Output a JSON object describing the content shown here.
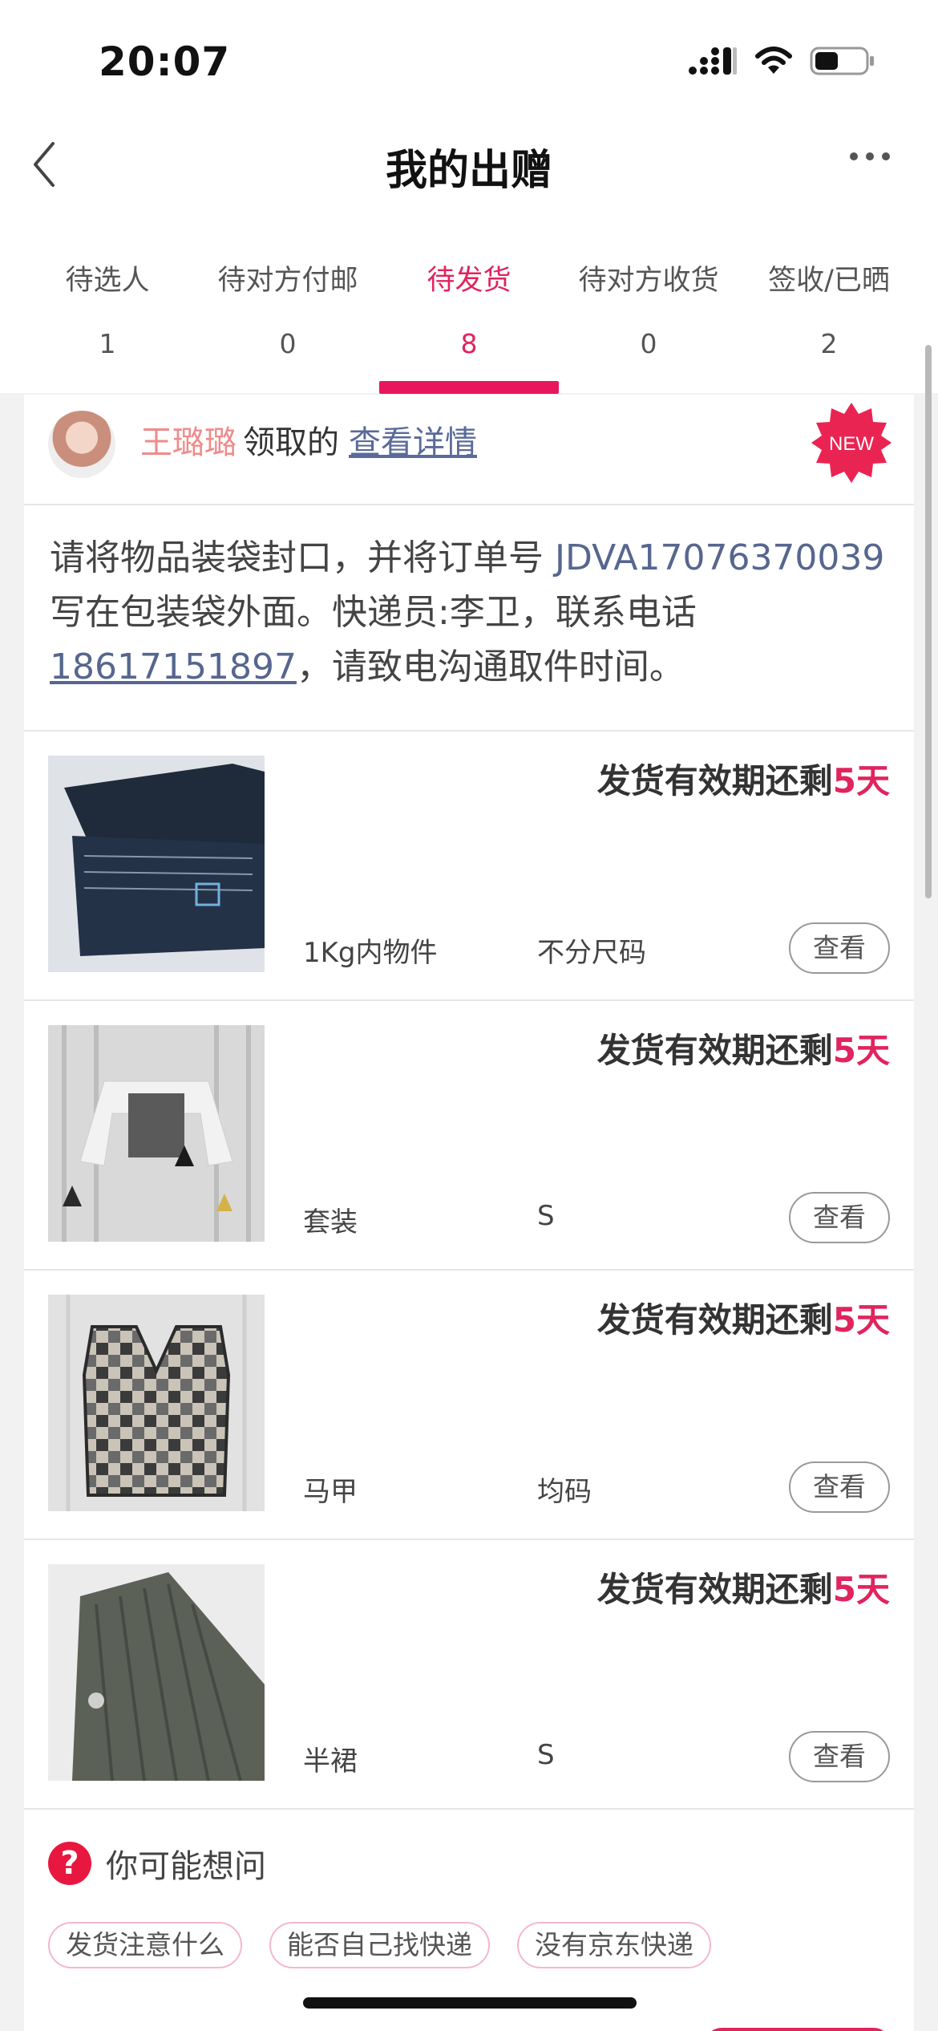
{
  "status_bar": {
    "time": "20:07"
  },
  "nav": {
    "title": "我的出赠"
  },
  "tabs": [
    {
      "label": "待选人",
      "count": "1"
    },
    {
      "label": "待对方付邮",
      "count": "0"
    },
    {
      "label": "待发货",
      "count": "8"
    },
    {
      "label": "待对方收货",
      "count": "0"
    },
    {
      "label": "签收/已晒",
      "count": "2"
    }
  ],
  "active_tab_index": 2,
  "receiver": {
    "name": "王璐璐",
    "action": "领取的",
    "link": "查看详情",
    "badge": "NEW"
  },
  "notice": {
    "part1": "请将物品装袋封口，并将订单号 ",
    "order_no": "JDVA17076370039",
    "part2": " 写在包装袋外面。快递员:李卫，联系电话",
    "phone": "18617151897",
    "part3": "，请致电沟通取件时间。"
  },
  "items": [
    {
      "deadline_prefix": "发货有效期还剩",
      "deadline_days": "5天",
      "name": "1Kg内物件",
      "size": "不分尺码",
      "button": "查看"
    },
    {
      "deadline_prefix": "发货有效期还剩",
      "deadline_days": "5天",
      "name": "套装",
      "size": "S",
      "button": "查看"
    },
    {
      "deadline_prefix": "发货有效期还剩",
      "deadline_days": "5天",
      "name": "马甲",
      "size": "均码",
      "button": "查看"
    },
    {
      "deadline_prefix": "发货有效期还剩",
      "deadline_days": "5天",
      "name": "半裙",
      "size": "S",
      "button": "查看"
    }
  ],
  "faq": {
    "icon": "?",
    "title": "你可能想问",
    "chips": [
      "发货注意什么",
      "能否自己找快递",
      "没有京东快递"
    ]
  },
  "colors": {
    "accent": "#e0245e",
    "link": "#56668f",
    "name_pink": "#f08a8a"
  }
}
